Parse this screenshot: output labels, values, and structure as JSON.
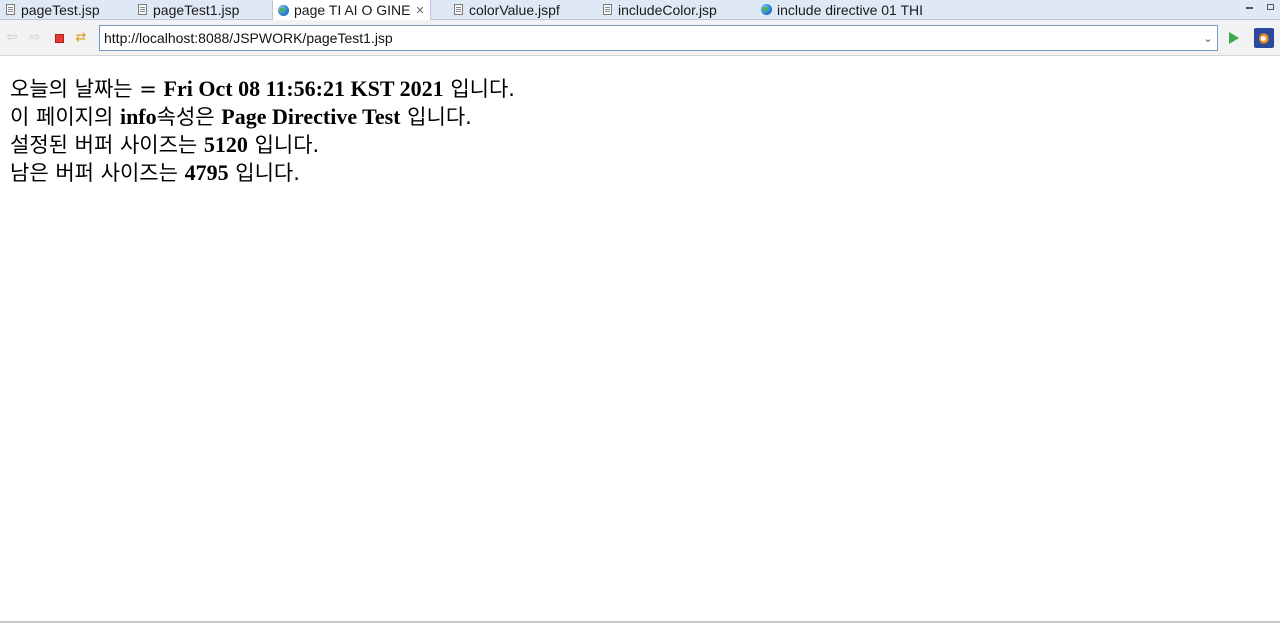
{
  "tabs": [
    {
      "label": "pageTest.jsp",
      "icon": "file-icon",
      "active": false
    },
    {
      "label": "pageTest1.jsp",
      "icon": "file-icon",
      "active": false
    },
    {
      "label": "page TI AI O GINE",
      "icon": "globe-icon",
      "active": true
    },
    {
      "label": "colorValue.jspf",
      "icon": "file-icon",
      "active": false
    },
    {
      "label": "includeColor.jsp",
      "icon": "file-icon",
      "active": false
    },
    {
      "label": "include directive 01 THI",
      "icon": "globe-icon",
      "active": false
    }
  ],
  "toolbar": {
    "url": "http://localhost:8088/JSPWORK/pageTest1.jsp"
  },
  "content": {
    "line1": {
      "prefix": "오늘의 날짜는 = ",
      "value": "Fri Oct 08 11:56:21 KST 2021",
      "suffix": " 입니다."
    },
    "line2": {
      "prefix": "이 페이지의 ",
      "bold": "info",
      "middle": "속성은 ",
      "value": "Page Directive Test",
      "suffix": " 입니다."
    },
    "line3": {
      "prefix": "설정된 버퍼 사이즈는 ",
      "value": "5120",
      "suffix": " 입니다."
    },
    "line4": {
      "prefix": "남은 버퍼 사이즈는 ",
      "value": "4795",
      "suffix": " 입니다."
    }
  }
}
